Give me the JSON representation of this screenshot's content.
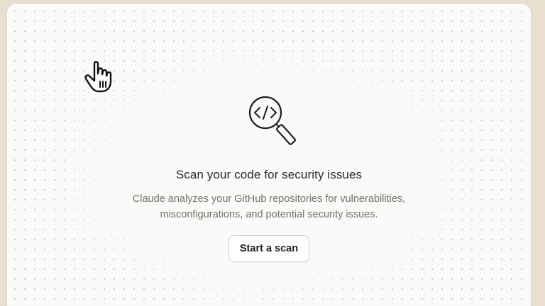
{
  "empty_state": {
    "icon": "code-magnifier-icon",
    "title": "Scan your code for security issues",
    "description_line1": "Claude analyzes your GitHub repositories for vulnerabilities,",
    "description_line2": "misconfigurations, and potential security issues.",
    "button_label": "Start a scan"
  },
  "cursor": {
    "icon": "hand-pointer-icon"
  },
  "colors": {
    "outer_background": "#e8dfd1",
    "panel_background": "#fafaf8",
    "title_text": "#2a2a28",
    "body_text": "#75716b"
  }
}
